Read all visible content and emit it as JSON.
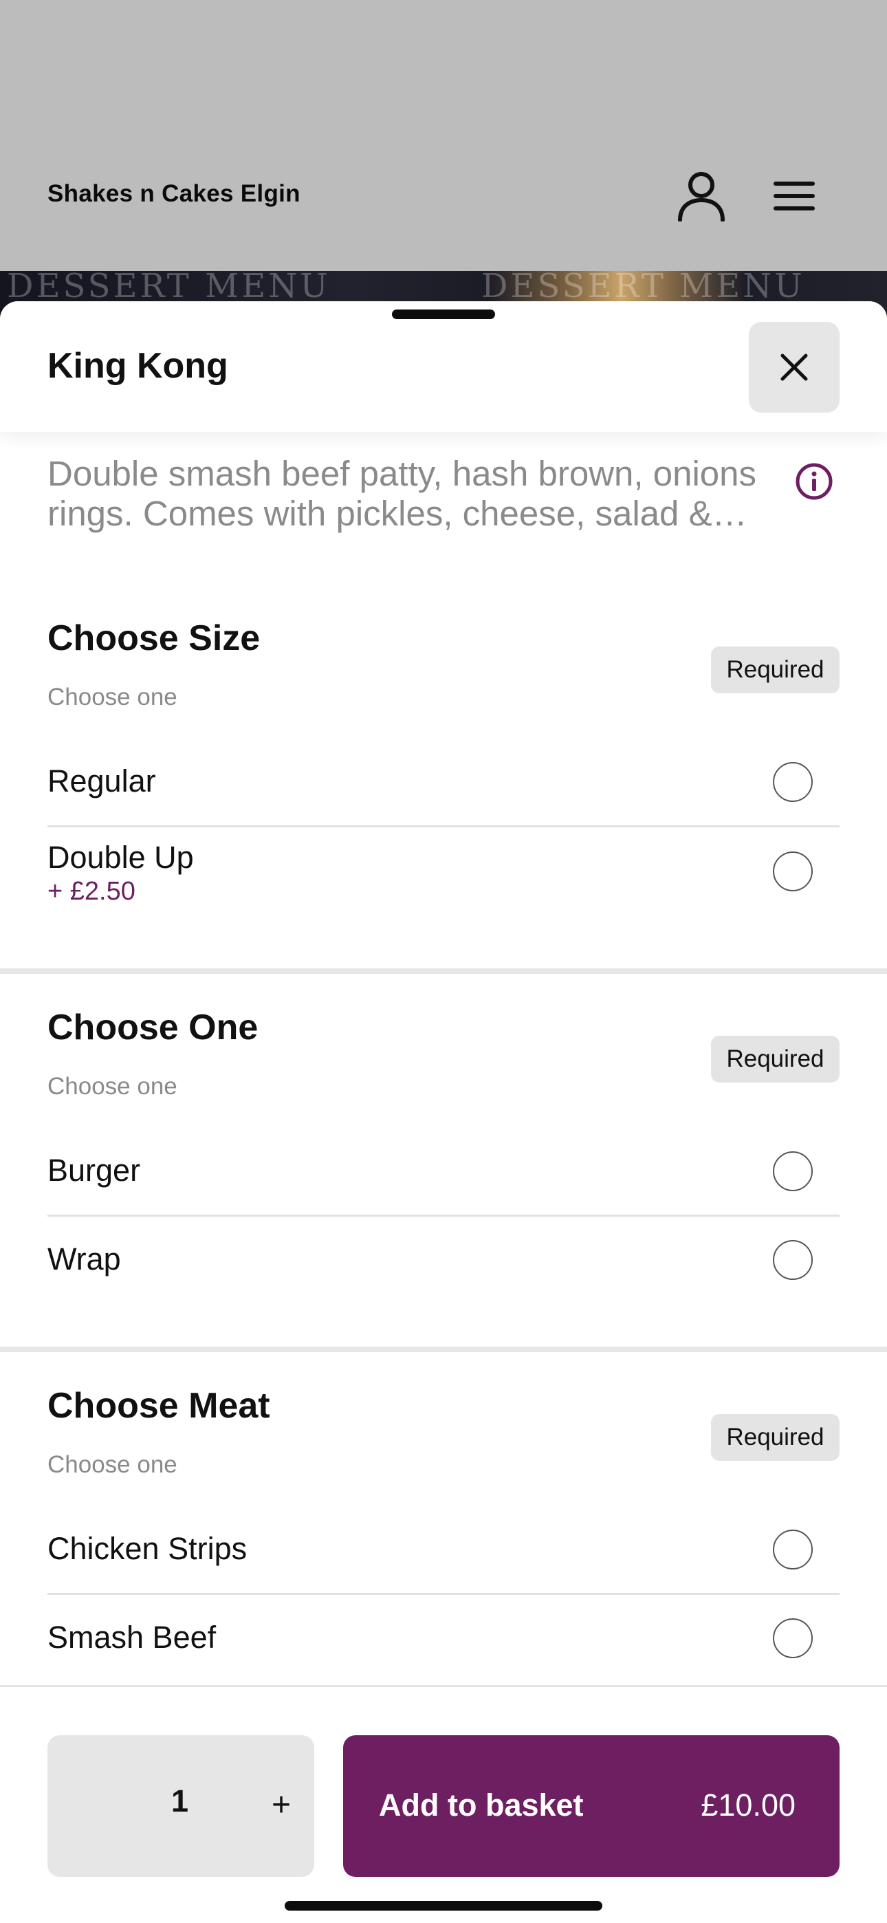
{
  "header": {
    "shop_name": "Shakes n Cakes Elgin",
    "account_icon": "user-icon",
    "menu_icon": "hamburger-menu-icon"
  },
  "hero": {
    "text_left": "DESSERT MENU",
    "text_right": "DESSERT MENU"
  },
  "sheet": {
    "title": "King Kong",
    "close_icon": "close-icon",
    "description": "Double smash beef patty, hash brown, onions rings. Comes with pickles, cheese, salad & sauce",
    "info_icon": "info-icon"
  },
  "groups": [
    {
      "title": "Choose Size",
      "subtitle": "Choose one",
      "badge": "Required",
      "options": [
        {
          "label": "Regular",
          "price": ""
        },
        {
          "label": "Double Up",
          "price": "+ £2.50"
        }
      ]
    },
    {
      "title": "Choose One",
      "subtitle": "Choose one",
      "badge": "Required",
      "options": [
        {
          "label": "Burger",
          "price": ""
        },
        {
          "label": "Wrap",
          "price": ""
        }
      ]
    },
    {
      "title": "Choose Meat",
      "subtitle": "Choose one",
      "badge": "Required",
      "options": [
        {
          "label": "Chicken Strips",
          "price": ""
        },
        {
          "label": "Smash Beef",
          "price": ""
        }
      ]
    }
  ],
  "footer": {
    "quantity": "1",
    "plus_label": "+",
    "add_label": "Add to basket",
    "total": "£10.00"
  },
  "colors": {
    "brand": "#6e1f62",
    "scrim": "#bcbcbc",
    "badge_bg": "#e4e4e4"
  }
}
